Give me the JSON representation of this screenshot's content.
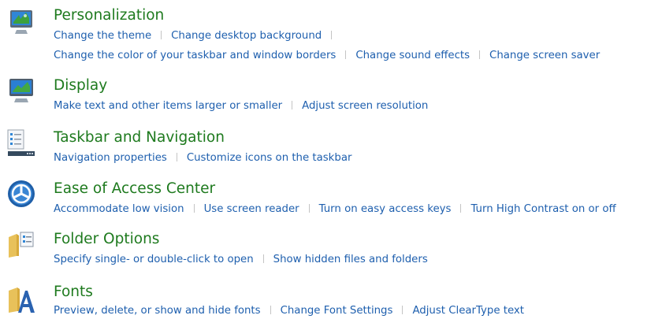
{
  "categories": [
    {
      "title": "Personalization",
      "icon": "personalization-monitor-icon",
      "lines": [
        [
          "Change the theme",
          "Change desktop background"
        ],
        [
          "Change the color of your taskbar and window borders",
          "Change sound effects",
          "Change screen saver"
        ]
      ]
    },
    {
      "title": "Display",
      "icon": "display-monitor-icon",
      "lines": [
        [
          "Make text and other items larger or smaller",
          "Adjust screen resolution"
        ]
      ]
    },
    {
      "title": "Taskbar and Navigation",
      "icon": "taskbar-icon",
      "lines": [
        [
          "Navigation properties",
          "Customize icons on the taskbar"
        ]
      ]
    },
    {
      "title": "Ease of Access Center",
      "icon": "ease-of-access-icon",
      "lines": [
        [
          "Accommodate low vision",
          "Use screen reader",
          "Turn on easy access keys",
          "Turn High Contrast on or off"
        ]
      ]
    },
    {
      "title": "Folder Options",
      "icon": "folder-options-icon",
      "lines": [
        [
          "Specify single- or double-click to open",
          "Show hidden files and folders"
        ]
      ]
    },
    {
      "title": "Fonts",
      "icon": "fonts-icon",
      "lines": [
        [
          "Preview, delete, or show and hide fonts",
          "Change Font Settings",
          "Adjust ClearType text"
        ]
      ]
    }
  ],
  "colors": {
    "title": "#1e7a1e",
    "link": "#1e5fae",
    "separator": "#c4c4c4"
  }
}
